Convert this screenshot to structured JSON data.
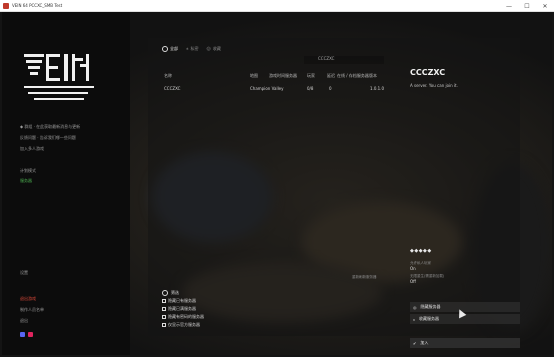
{
  "window": {
    "title": "VEIN 64 PCCXC_SMB Test",
    "minimize": "—",
    "maximize": "☐",
    "close": "✕"
  },
  "sidebar": {
    "logo_text": "VEIN",
    "links": [
      "◆ 群组 · 在此获取最新消息与更新",
      "反馈问题 · 告诉我们哪一些问题",
      "加入多人游戏"
    ],
    "section_a": [
      "计划模式",
      "服务器"
    ],
    "settings": "设置",
    "quit_group": [
      "退出游戏",
      "制作人员名单",
      "退出"
    ]
  },
  "panel": {
    "tabs": [
      {
        "label": "全部",
        "active": true
      },
      {
        "label": "私密"
      },
      {
        "label": "收藏"
      }
    ],
    "search_value": "CCCZXC",
    "columns": [
      "名称",
      "地图",
      "游戏时间服务器",
      "玩家",
      "延迟",
      "在线 / 存档服务器",
      "版本"
    ],
    "rows": [
      {
        "name": "CCCZXC",
        "map": "Champion Valley",
        "time": "",
        "players": "0/8",
        "ping": "0",
        "online": "",
        "version": "1.0.1.0"
      }
    ],
    "refresh_link": "重新刷新服务器",
    "bulk": {
      "header": "筛选",
      "options": [
        "隐藏已有服务器",
        "隐藏已满服务器",
        "隐藏有密码的服务器",
        "仅显示官方服务器"
      ]
    }
  },
  "details": {
    "server_name": "CCCZXC",
    "description": "A server. You can join it.",
    "rating": "◆◆◆◆◆",
    "stat_1_label": "允许私人玩家",
    "stat_1_value": "On",
    "stat_2_label": "无限重生(需重新加载)",
    "stat_2_value": "Off",
    "actions": {
      "hide": "隐藏服务器",
      "favorite": "收藏服务器",
      "join": "加入"
    }
  },
  "colors": {
    "accent_green": "#4caf50",
    "accent_red": "#e04a3a",
    "background": "#141414"
  }
}
